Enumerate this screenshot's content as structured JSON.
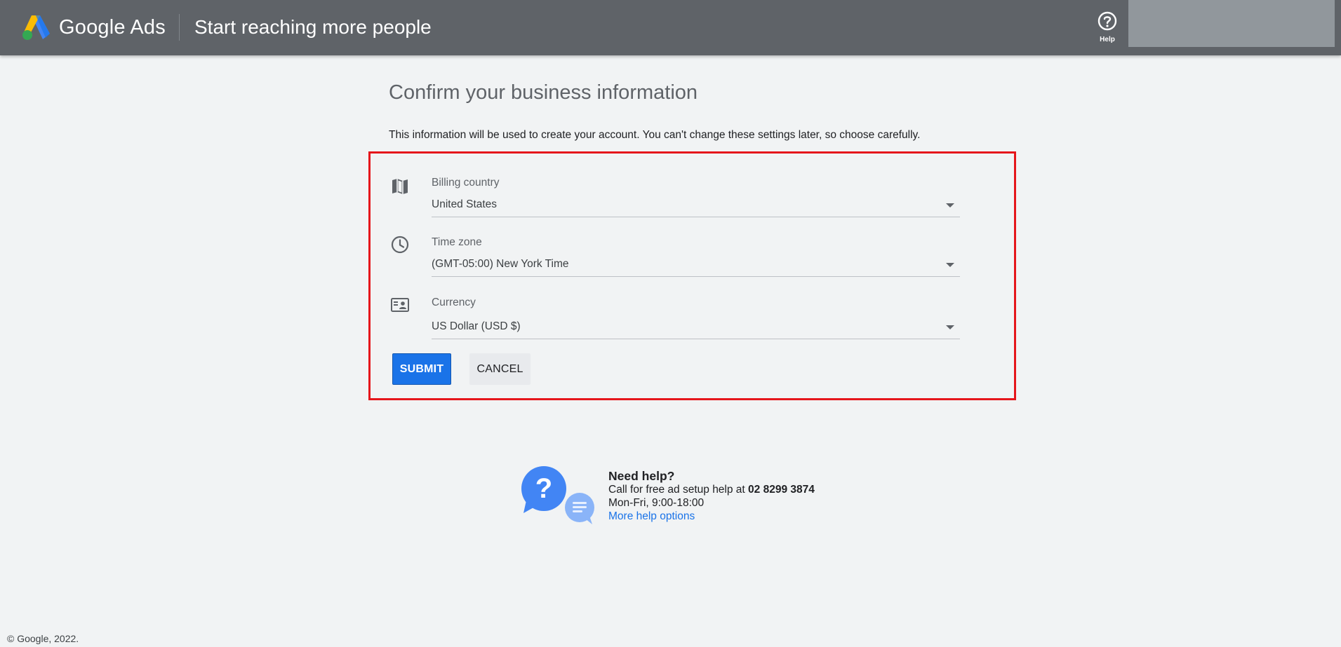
{
  "header": {
    "brand": "Google Ads",
    "title": "Start reaching more people",
    "help_label": "Help",
    "help_icon": "help-circle-icon",
    "logo_icon": "google-ads-logo-icon"
  },
  "main": {
    "title": "Confirm your business information",
    "intro": "This information will be used to create your account. You can't change these settings later, so choose carefully.",
    "fields": [
      {
        "label": "Billing country",
        "value": "United States",
        "icon": "map-icon"
      },
      {
        "label": "Time zone",
        "value": "(GMT-05:00) New York Time",
        "icon": "clock-icon"
      },
      {
        "label": "Currency",
        "value": "US Dollar (USD $)",
        "icon": "currency-icon"
      }
    ],
    "submit_label": "SUBMIT",
    "cancel_label": "CANCEL"
  },
  "help": {
    "title": "Need help?",
    "call_text": "Call for free ad setup help at ",
    "phone": "02 8299 3874",
    "hours": "Mon-Fri, 9:00-18:00",
    "more_link": "More help options"
  },
  "footer": {
    "copyright": "© Google, 2022."
  },
  "colors": {
    "header_bg": "#5f6368",
    "page_bg": "#f1f3f4",
    "primary_blue": "#1a73e8",
    "highlight_red": "#e5161b"
  }
}
